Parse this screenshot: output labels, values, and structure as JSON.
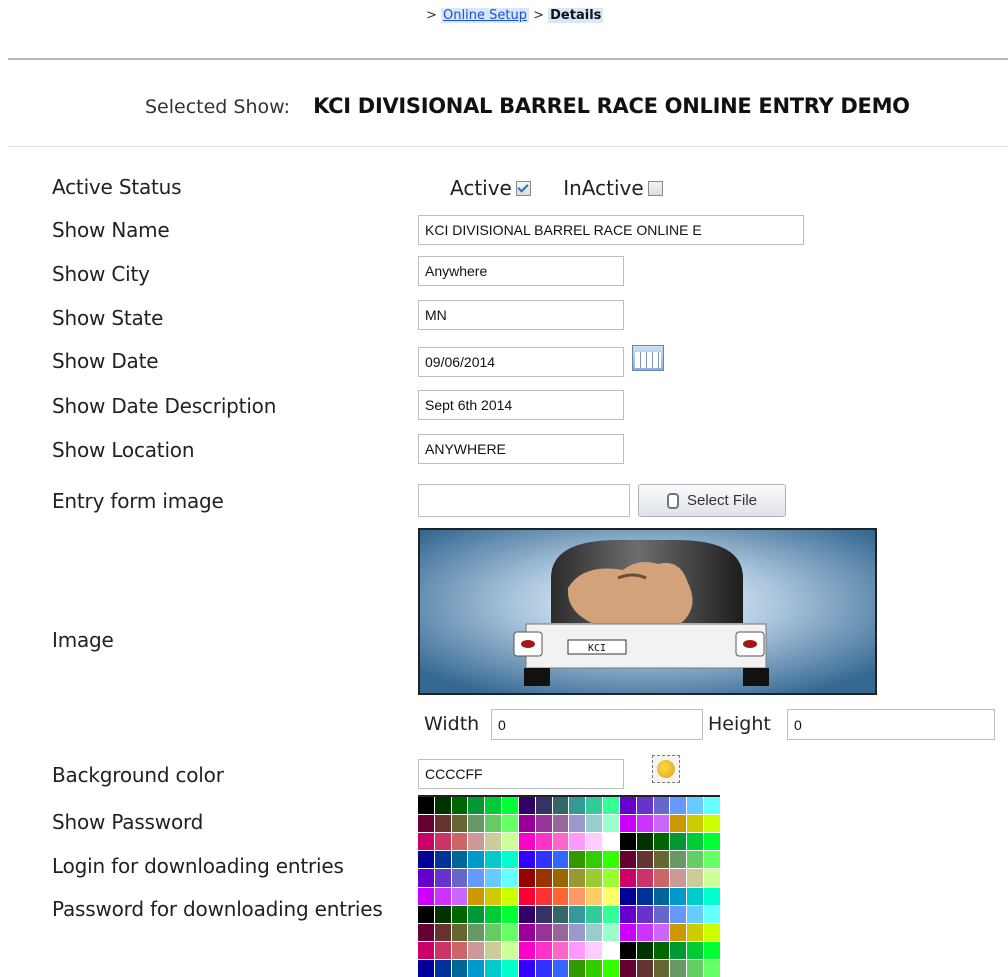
{
  "breadcrumb": {
    "prefix": ">",
    "link": "Online Setup",
    "separator": ">",
    "current": "Details"
  },
  "selected_show": {
    "label": "Selected Show:",
    "name": "KCI DIVISIONAL BARREL RACE ONLINE ENTRY DEMO"
  },
  "form": {
    "active_status_label": "Active Status",
    "active_label": "Active",
    "active_checked": true,
    "inactive_label": "InActive",
    "inactive_checked": false,
    "show_name_label": "Show Name",
    "show_name_value": "KCI DIVISIONAL BARREL RACE ONLINE E",
    "show_city_label": "Show City",
    "show_city_value": "Anywhere",
    "show_state_label": "Show State",
    "show_state_value": "MN",
    "show_date_label": "Show Date",
    "show_date_value": "09/06/2014",
    "show_date_desc_label": "Show Date Description",
    "show_date_desc_value": "Sept 6th 2014",
    "show_location_label": "Show Location",
    "show_location_value": "ANYWHERE",
    "entry_form_image_label": "Entry form image",
    "entry_form_image_value": "",
    "select_file_label": "Select File",
    "image_label": "Image",
    "image_sign_text": "KCI",
    "width_label": "Width",
    "width_value": "0",
    "height_label": "Height",
    "height_value": "0",
    "background_color_label": "Background color",
    "background_color_value": "CCCCFF",
    "show_password_label": "Show Password",
    "login_download_label": "Login for downloading entries",
    "password_download_label": "Password for downloading entries"
  },
  "icons": {
    "calendar": "calendar-icon",
    "color_picker": "color-picker-icon",
    "paperclip": "paperclip-icon"
  },
  "colors": {
    "link": "#1a4fd6",
    "breadcrumb_highlight": "#d7e8fb",
    "image_bg": "#4f7fa8"
  }
}
